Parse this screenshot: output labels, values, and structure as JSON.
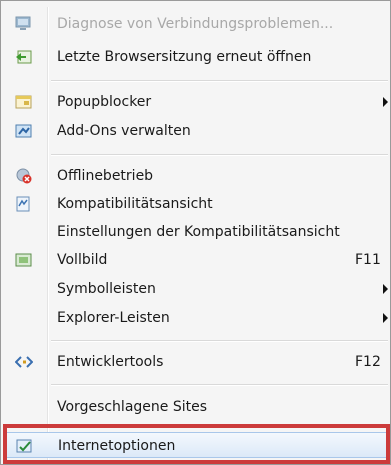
{
  "menu": {
    "items": [
      {
        "label": "Diagnose von Verbindungsproblemen...",
        "icon": "diagnose-icon",
        "disabled": true
      },
      {
        "label": "Letzte Browsersitzung erneut öffnen",
        "icon": "reopen-session-icon"
      },
      {
        "label": "Popupblocker",
        "icon": "popup-blocker-icon",
        "submenu": true
      },
      {
        "label": "Add-Ons verwalten",
        "icon": "addons-icon"
      },
      {
        "label": "Offlinebetrieb",
        "icon": "offline-icon"
      },
      {
        "label": "Kompatibilitätsansicht",
        "icon": "compatibility-icon"
      },
      {
        "label": "Einstellungen der Kompatibilitätsansicht",
        "icon": ""
      },
      {
        "label": "Vollbild",
        "icon": "fullscreen-icon",
        "shortcut": "F11"
      },
      {
        "label": "Symbolleisten",
        "icon": "",
        "submenu": true
      },
      {
        "label": "Explorer-Leisten",
        "icon": "",
        "submenu": true
      },
      {
        "label": "Entwicklertools",
        "icon": "developer-tools-icon",
        "shortcut": "F12"
      },
      {
        "label": "Vorgeschlagene Sites",
        "icon": ""
      },
      {
        "label": "Internetoptionen",
        "icon": "internet-options-icon",
        "highlighted": true
      }
    ]
  },
  "colors": {
    "highlight_outline": "#cc3b3b",
    "menu_background": "#f5f5f5",
    "disabled_text": "#a8a8a8"
  }
}
